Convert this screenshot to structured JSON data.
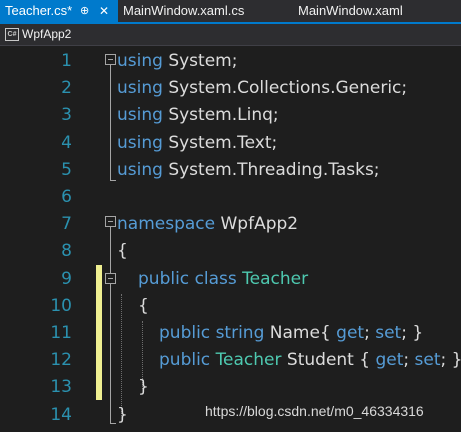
{
  "tabs": [
    {
      "label": "Teacher.cs*",
      "pin": "⊕",
      "close": "✕"
    },
    {
      "label": "MainWindow.xaml.cs"
    },
    {
      "label": "MainWindow.xaml"
    }
  ],
  "nav": {
    "icon": "C#",
    "project": "WpfApp2"
  },
  "code": [
    {
      "n": "1",
      "parts": [
        {
          "k": "kw",
          "t": "using"
        },
        {
          "k": "tx",
          "t": " System;"
        }
      ]
    },
    {
      "n": "2",
      "parts": [
        {
          "k": "kw",
          "t": "using"
        },
        {
          "k": "tx",
          "t": " System.Collections.Generic;"
        }
      ]
    },
    {
      "n": "3",
      "parts": [
        {
          "k": "kw",
          "t": "using"
        },
        {
          "k": "tx",
          "t": " System.Linq;"
        }
      ]
    },
    {
      "n": "4",
      "parts": [
        {
          "k": "kw",
          "t": "using"
        },
        {
          "k": "tx",
          "t": " System.Text;"
        }
      ]
    },
    {
      "n": "5",
      "parts": [
        {
          "k": "kw",
          "t": "using"
        },
        {
          "k": "tx",
          "t": " System.Threading.Tasks;"
        }
      ]
    },
    {
      "n": "6",
      "parts": []
    },
    {
      "n": "7",
      "parts": [
        {
          "k": "kw",
          "t": "namespace"
        },
        {
          "k": "tx",
          "t": " WpfApp2"
        }
      ]
    },
    {
      "n": "8",
      "parts": [
        {
          "k": "tx",
          "t": "{"
        }
      ]
    },
    {
      "n": "9",
      "parts": [
        {
          "k": "kw",
          "t": "public"
        },
        {
          "k": "tx",
          "t": " "
        },
        {
          "k": "kw",
          "t": "class"
        },
        {
          "k": "tx",
          "t": " "
        },
        {
          "k": "typ",
          "t": "Teacher"
        }
      ]
    },
    {
      "n": "10",
      "parts": [
        {
          "k": "tx",
          "t": "{"
        }
      ]
    },
    {
      "n": "11",
      "parts": [
        {
          "k": "kw",
          "t": "public"
        },
        {
          "k": "tx",
          "t": " "
        },
        {
          "k": "kw",
          "t": "string"
        },
        {
          "k": "tx",
          "t": " Name{ "
        },
        {
          "k": "kw",
          "t": "get"
        },
        {
          "k": "tx",
          "t": "; "
        },
        {
          "k": "kw",
          "t": "set"
        },
        {
          "k": "tx",
          "t": "; }"
        }
      ]
    },
    {
      "n": "12",
      "parts": [
        {
          "k": "kw",
          "t": "public"
        },
        {
          "k": "tx",
          "t": " "
        },
        {
          "k": "typ",
          "t": "Teacher"
        },
        {
          "k": "tx",
          "t": " Student { "
        },
        {
          "k": "kw",
          "t": "get"
        },
        {
          "k": "tx",
          "t": "; "
        },
        {
          "k": "kw",
          "t": "set"
        },
        {
          "k": "tx",
          "t": "; }"
        }
      ]
    },
    {
      "n": "13",
      "parts": [
        {
          "k": "tx",
          "t": "}"
        }
      ]
    },
    {
      "n": "14",
      "parts": [
        {
          "k": "tx",
          "t": "}"
        }
      ]
    }
  ],
  "watermark": "https://blog.csdn.net/m0_46334316",
  "colors": {
    "keyword": "#569cd6",
    "type": "#4ec9b0",
    "text": "#dcdcdc",
    "line_number": "#2b91af",
    "tab_active": "#007acc",
    "change_bar": "#efef91"
  }
}
